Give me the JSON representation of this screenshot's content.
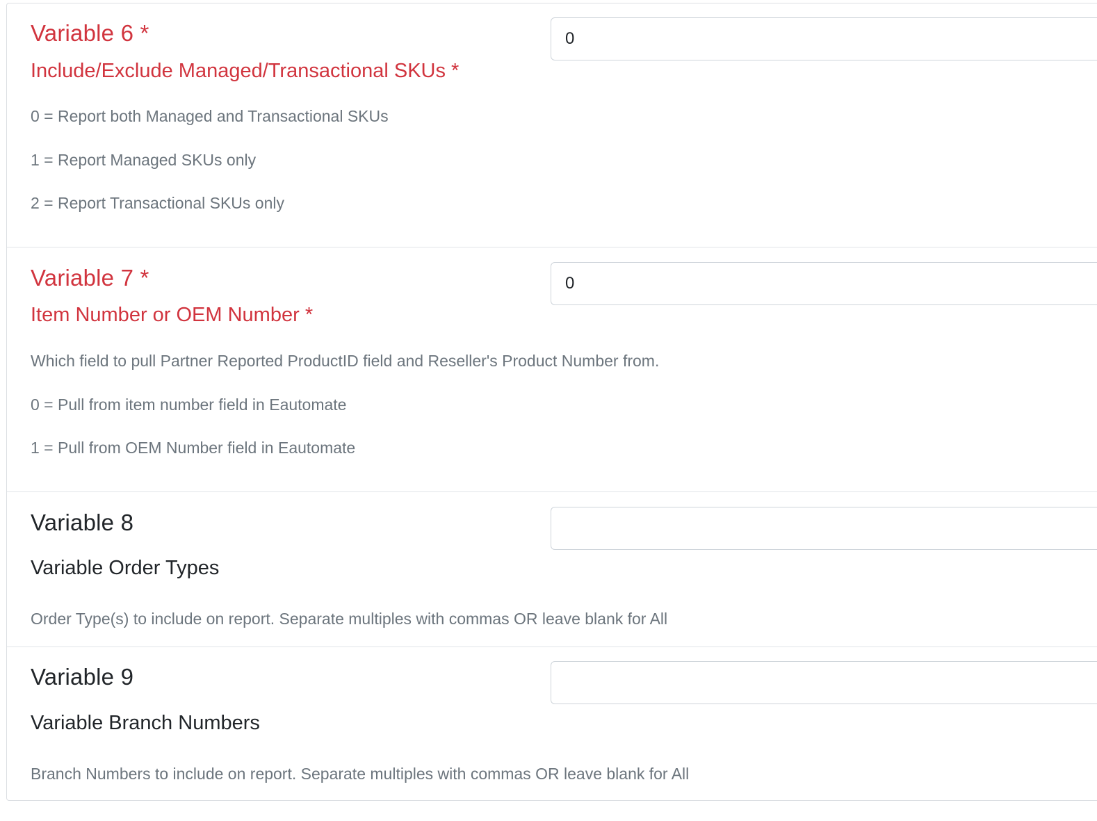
{
  "variables": [
    {
      "title": "Variable 6 *",
      "subtitle": "Include/Exclude Managed/Transactional SKUs *",
      "value": "0",
      "required": true,
      "help": [
        "0 = Report both Managed and Transactional SKUs",
        "1 = Report Managed SKUs only",
        "2 = Report Transactional SKUs only"
      ]
    },
    {
      "title": "Variable 7 *",
      "subtitle": "Item Number or OEM Number *",
      "value": "0",
      "required": true,
      "help": [
        "Which field to pull Partner Reported ProductID field and Reseller's Product Number from.",
        "0 = Pull from item number field in Eautomate",
        "1 = Pull from OEM Number field in Eautomate"
      ]
    },
    {
      "title": "Variable 8",
      "subtitle": "Variable Order Types",
      "value": "",
      "required": false,
      "help": [
        "Order Type(s) to include on report. Separate multiples with commas OR leave blank for All"
      ]
    },
    {
      "title": "Variable 9",
      "subtitle": "Variable Branch Numbers",
      "value": "",
      "required": false,
      "help": [
        "Branch Numbers to include on report. Separate multiples with commas OR leave blank for All"
      ]
    }
  ],
  "colors": {
    "required": "#d1343e",
    "normal": "#212529",
    "help": "#6c757d",
    "border": "#ced4da"
  }
}
